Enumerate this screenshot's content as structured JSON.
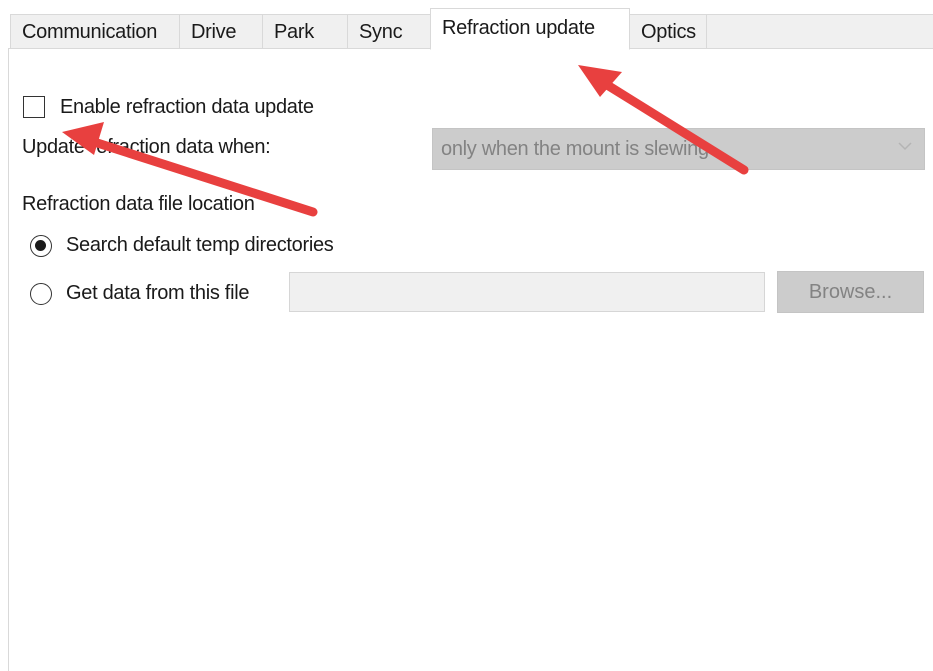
{
  "tabs": [
    {
      "label": "Communication"
    },
    {
      "label": "Drive"
    },
    {
      "label": "Park"
    },
    {
      "label": "Sync"
    },
    {
      "label": "Refraction update",
      "active": true
    },
    {
      "label": "Optics"
    }
  ],
  "refraction": {
    "enable_label": "Enable refraction data update",
    "enable_checked": false,
    "update_when_label": "Update refraction data when:",
    "update_when_value": "only when the mount is slewing",
    "location_label": "Refraction data file location",
    "option_default_label": "Search default temp directories",
    "option_default_selected": true,
    "option_file_label": "Get data from this file",
    "option_file_selected": false,
    "file_path_value": "",
    "browse_label": "Browse..."
  },
  "annotations": {
    "arrow_color": "#e8403f"
  },
  "colors": {
    "tab_inactive_bg": "#f0f0f0",
    "disabled_control_bg": "#cccccc",
    "disabled_text": "#838383"
  }
}
